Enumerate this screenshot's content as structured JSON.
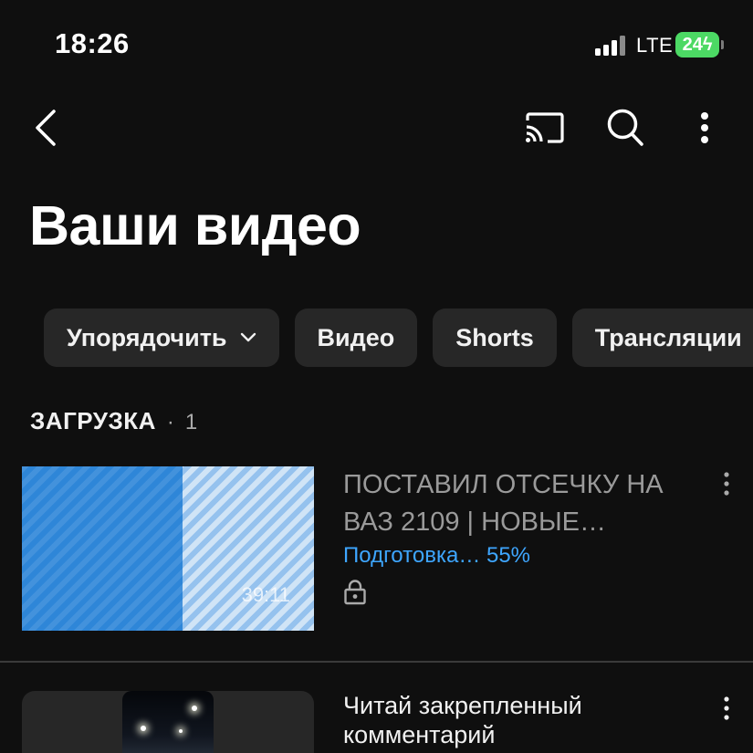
{
  "status_bar": {
    "time": "18:26",
    "network": "LTE",
    "battery": "24",
    "battery_color": "#4cd964"
  },
  "top_bar": {
    "back_icon": "chevron-left-icon",
    "cast_icon": "cast-icon",
    "search_icon": "search-icon",
    "more_icon": "more-vertical-icon"
  },
  "page": {
    "title": "Ваши видео"
  },
  "chips": [
    {
      "label": "Упорядочить",
      "icon": "chevron-down-icon"
    },
    {
      "label": "Видео"
    },
    {
      "label": "Shorts"
    },
    {
      "label": "Трансляции"
    }
  ],
  "section": {
    "title": "ЗАГРУЗКА",
    "separator": "·",
    "count": "1"
  },
  "videos": [
    {
      "title": "ПОСТАВИЛ ОТСЕЧКУ НА ВАЗ 2109 | НОВЫЕ…",
      "status": "Подготовка… 55%",
      "progress": 0.55,
      "duration": "39:11",
      "visibility_icon": "lock-icon",
      "status_color": "#3ea6ff",
      "thumb_color": "#2e86d8"
    },
    {
      "title": "Читай закрепленный комментарий"
    }
  ],
  "colors": {
    "background": "#0f0f0f",
    "chip_background": "#272727",
    "accent": "#3ea6ff"
  }
}
